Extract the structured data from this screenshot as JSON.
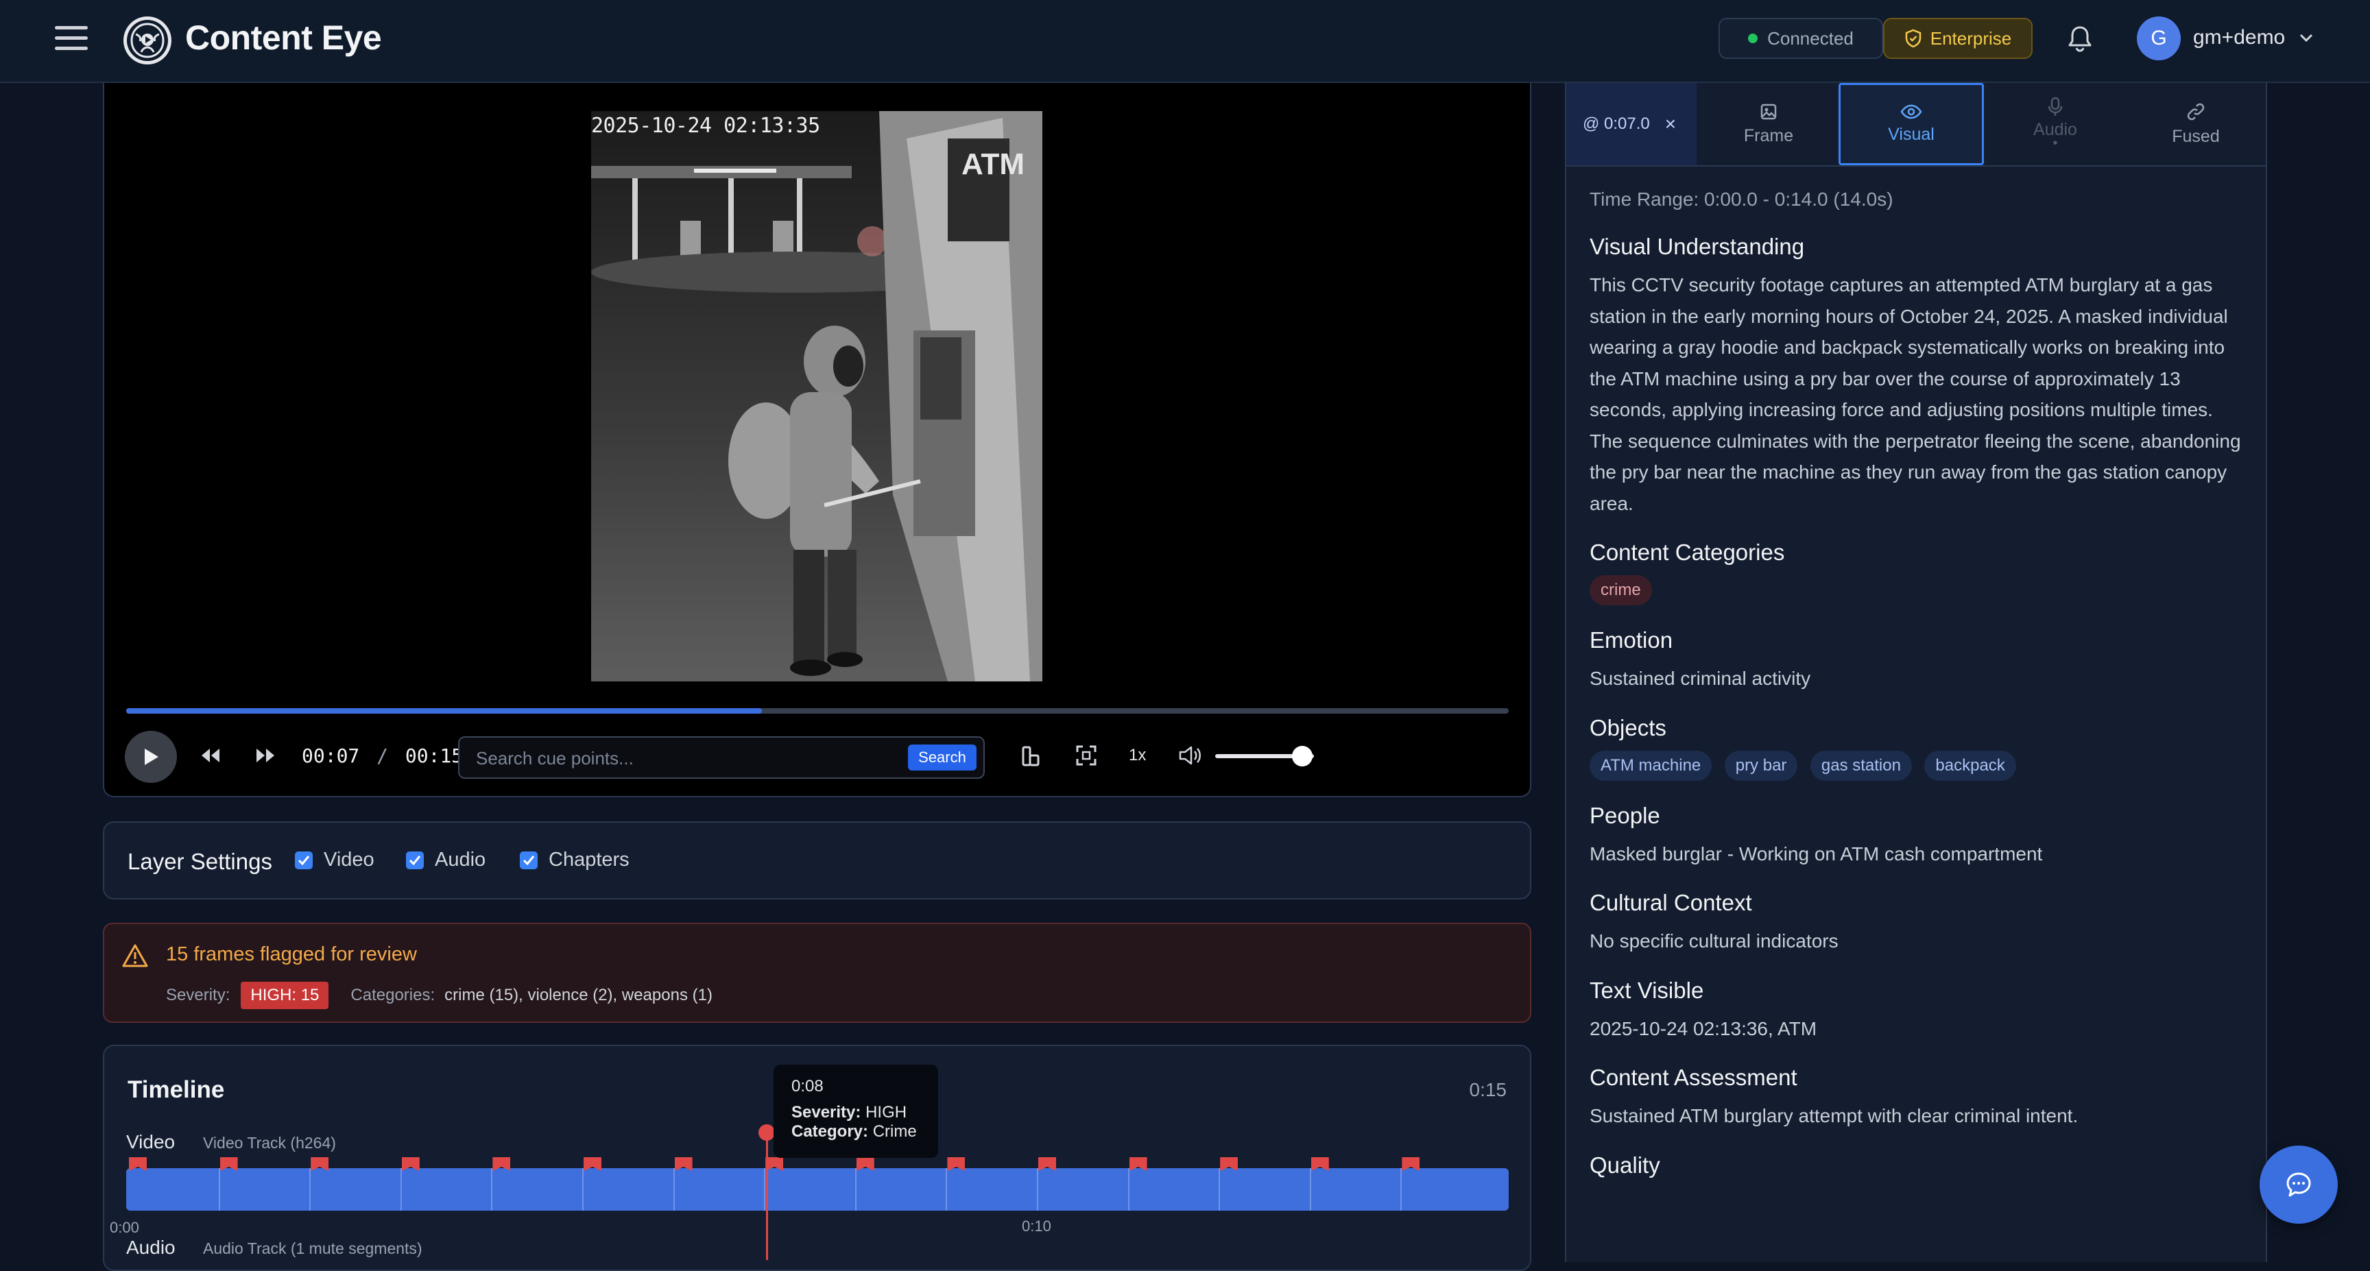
{
  "app": {
    "title": "Content Eye"
  },
  "header": {
    "status": "Connected",
    "plan": "Enterprise",
    "user": {
      "initial": "G",
      "name": "gm+demo"
    }
  },
  "video": {
    "timestamp_overlay": "2025-10-24 02:13:35",
    "current_time": "00:07",
    "separator": "/",
    "duration": "00:15",
    "progress_fraction": 0.46,
    "search_placeholder": "Search cue points...",
    "search_button": "Search",
    "speed": "1x",
    "volume_fraction": 0.88
  },
  "layers": {
    "title": "Layer Settings",
    "items": [
      {
        "label": "Video",
        "checked": true
      },
      {
        "label": "Audio",
        "checked": true
      },
      {
        "label": "Chapters",
        "checked": true
      }
    ]
  },
  "flagged": {
    "title": "15 frames flagged for review",
    "severity_label": "Severity:",
    "severity_value": "HIGH: 15",
    "categories_label": "Categories:",
    "categories_value": "crime (15), violence (2), weapons (1)"
  },
  "timeline": {
    "title": "Timeline",
    "duration": "0:15",
    "video_label": "Video",
    "video_sub": "Video Track (h264)",
    "audio_label": "Audio",
    "audio_sub": "Audio Track (1 mute segments)",
    "tick_start": "0:00",
    "tick_mid": "0:10",
    "tooltip": {
      "time": "0:08",
      "severity_label": "Severity:",
      "severity_value": "HIGH",
      "category_label": "Category:",
      "category_value": "Crime"
    }
  },
  "panel": {
    "tabs": {
      "time": "@ 0:07.0",
      "close": "×",
      "frame": "Frame",
      "visual": "Visual",
      "audio": "Audio",
      "audio_dot": "•",
      "fused": "Fused"
    },
    "time_range": "Time Range: 0:00.0 - 0:14.0 (14.0s)",
    "visual_understanding_title": "Visual Understanding",
    "visual_understanding": "This CCTV security footage captures an attempted ATM burglary at a gas station in the early morning hours of October 24, 2025. A masked individual wearing a gray hoodie and backpack systematically works on breaking into the ATM machine using a pry bar over the course of approximately 13 seconds, applying increasing force and adjusting positions multiple times. The sequence culminates with the perpetrator fleeing the scene, abandoning the pry bar near the machine as they run away from the gas station canopy area.",
    "categories_title": "Content Categories",
    "categories": [
      "crime"
    ],
    "emotion_title": "Emotion",
    "emotion": "Sustained criminal activity",
    "objects_title": "Objects",
    "objects": [
      "ATM machine",
      "pry bar",
      "gas station",
      "backpack"
    ],
    "people_title": "People",
    "people": "Masked burglar - Working on ATM cash compartment",
    "cultural_title": "Cultural Context",
    "cultural": "No specific cultural indicators",
    "text_title": "Text Visible",
    "text": "2025-10-24 02:13:36, ATM",
    "assessment_title": "Content Assessment",
    "assessment": "Sustained ATM burglary attempt with clear criminal intent.",
    "quality_title": "Quality"
  },
  "colors": {
    "background": "#0d1525",
    "accent": "#3b82f6",
    "flag": "#e04848",
    "warning": "#f4a94a",
    "enterprise": "#f4c94d"
  }
}
